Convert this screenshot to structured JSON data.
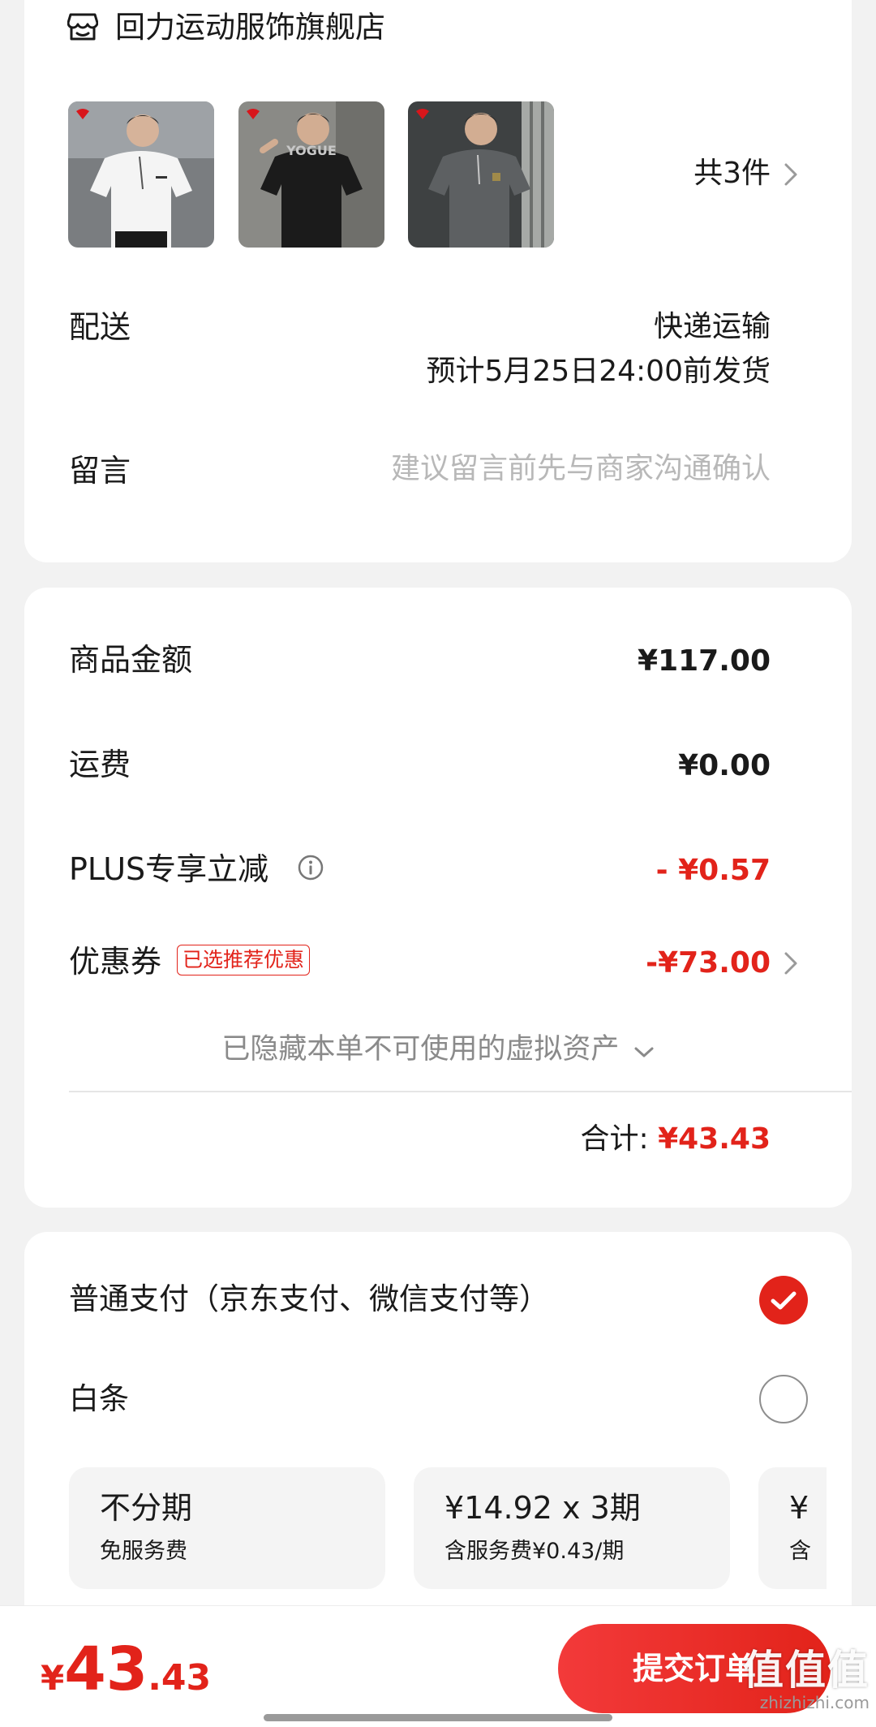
{
  "shop": {
    "icon": "shop-icon",
    "name": "回力运动服饰旗舰店",
    "products": [
      {
        "name": "white-tshirt",
        "color": "#f2f2f2"
      },
      {
        "name": "black-tshirt",
        "color": "#1c1c1c"
      },
      {
        "name": "grey-tshirt",
        "color": "#6e6e6e"
      }
    ],
    "count_label": "共3件",
    "delivery": {
      "label": "配送",
      "method": "快递运输",
      "eta": "预计5月25日24:00前发货"
    },
    "remark": {
      "label": "留言",
      "placeholder": "建议留言前先与商家沟通确认"
    }
  },
  "price": {
    "goods_label": "商品金额",
    "goods_value": "¥117.00",
    "shipping_label": "运费",
    "shipping_value": "¥0.00",
    "plus_label": "PLUS专享立减",
    "plus_value": "- ¥0.57",
    "coupon_label": "优惠券",
    "coupon_badge": "已选推荐优惠",
    "coupon_value": "-¥73.00",
    "hidden_assets": "已隐藏本单不可使用的虚拟资产",
    "total_label": "合计:",
    "total_value": "¥43.43"
  },
  "payment": {
    "normal_label": "普通支付（京东支付、微信支付等）",
    "normal_selected": true,
    "baitiao_label": "白条",
    "baitiao_selected": false,
    "installments": [
      {
        "title": "不分期",
        "sub": "免服务费"
      },
      {
        "title": "¥14.92 x 3期",
        "sub": "含服务费¥0.43/期"
      },
      {
        "title": "¥",
        "sub": "含"
      }
    ]
  },
  "footer": {
    "currency": "¥",
    "amount_int": "43",
    "amount_dec": ".43",
    "submit_label": "提交订单"
  },
  "watermark": {
    "main": "值值值",
    "sub": "zhizhizhi.com"
  },
  "colors": {
    "accent": "#e2231a",
    "background": "#f2f2f2",
    "card": "#ffffff"
  }
}
